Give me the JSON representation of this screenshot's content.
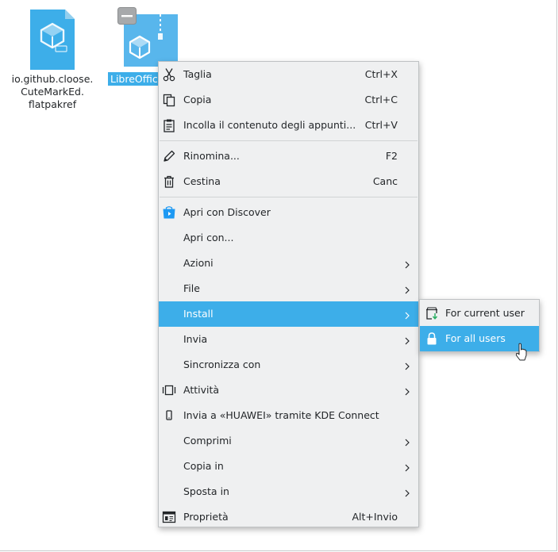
{
  "desktop": {
    "files": [
      {
        "label": "io.github.cloose.\nCuteMarkEd.\nflatpakref",
        "icon": "flatpak-ref-file-icon",
        "selected": false
      },
      {
        "label": "LibreOffice",
        "icon": "flatpak-bundle-archive-icon",
        "selected": true
      }
    ]
  },
  "context_menu": {
    "items": [
      {
        "label": "Taglia",
        "shortcut": "Ctrl+X",
        "icon": "scissors-icon"
      },
      {
        "label": "Copia",
        "shortcut": "Ctrl+C",
        "icon": "copy-icon"
      },
      {
        "label": "Incolla il contenuto degli appunti...",
        "shortcut": "Ctrl+V",
        "icon": "paste-icon"
      },
      {
        "label": "Rinomina...",
        "shortcut": "F2",
        "icon": "pencil-icon"
      },
      {
        "label": "Cestina",
        "shortcut": "Canc",
        "icon": "trash-icon"
      },
      {
        "label": "Apri con Discover",
        "shortcut": "",
        "icon": "discover-icon"
      },
      {
        "label": "Apri con...",
        "shortcut": "",
        "icon": ""
      },
      {
        "label": "Azioni",
        "shortcut": "",
        "icon": "",
        "submenu": true
      },
      {
        "label": "File",
        "shortcut": "",
        "icon": "",
        "submenu": true
      },
      {
        "label": "Install",
        "shortcut": "",
        "icon": "",
        "submenu": true,
        "highlighted": true
      },
      {
        "label": "Invia",
        "shortcut": "",
        "icon": "",
        "submenu": true
      },
      {
        "label": "Sincronizza con",
        "shortcut": "",
        "icon": "",
        "submenu": true
      },
      {
        "label": "Attività",
        "shortcut": "",
        "icon": "activities-icon",
        "submenu": true
      },
      {
        "label": "Invia a «HUAWEI» tramite KDE Connect",
        "shortcut": "",
        "icon": "smartphone-icon"
      },
      {
        "label": "Comprimi",
        "shortcut": "",
        "icon": "",
        "submenu": true
      },
      {
        "label": "Copia in",
        "shortcut": "",
        "icon": "",
        "submenu": true
      },
      {
        "label": "Sposta in",
        "shortcut": "",
        "icon": "",
        "submenu": true
      },
      {
        "label": "Proprietà",
        "shortcut": "Alt+Invio",
        "icon": "properties-icon"
      }
    ]
  },
  "install_submenu": {
    "items": [
      {
        "label": "For current user",
        "icon": "install-user-icon",
        "highlighted": false
      },
      {
        "label": "For all users",
        "icon": "lock-icon",
        "highlighted": true
      }
    ]
  },
  "colors": {
    "highlight": "#3daee9",
    "menu_background": "#eff0f1",
    "text": "#232629",
    "icon_blue": "#3daee9"
  }
}
